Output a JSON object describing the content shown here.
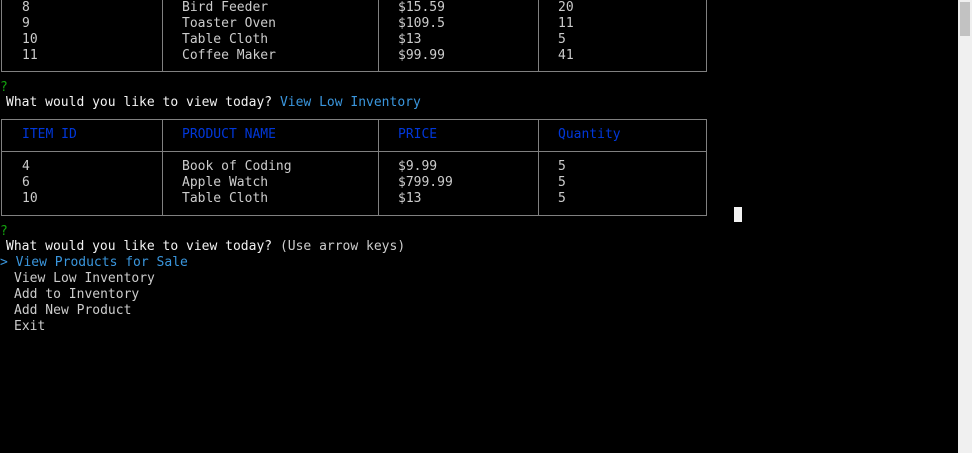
{
  "top_table": {
    "rows": [
      [
        "8",
        "Bird Feeder",
        "$15.59",
        "20"
      ],
      [
        "9",
        "Toaster Oven",
        "$109.5",
        "11"
      ],
      [
        "10",
        "Table Cloth",
        "$13",
        "5"
      ],
      [
        "11",
        "Coffee Maker",
        "$99.99",
        "41"
      ]
    ]
  },
  "prompt1": {
    "mark": "?",
    "question": "What would you like to view today?",
    "answer": "View Low Inventory"
  },
  "low_inventory_table": {
    "headers": [
      "ITEM ID",
      "PRODUCT NAME",
      "PRICE",
      "Quantity"
    ],
    "rows": [
      [
        "4",
        "Book of Coding",
        "$9.99",
        "5"
      ],
      [
        "6",
        "Apple Watch",
        "$799.99",
        "5"
      ],
      [
        "10",
        "Table Cloth",
        "$13",
        "5"
      ]
    ]
  },
  "prompt2": {
    "mark": "?",
    "question": "What would you like to view today?",
    "hint": "(Use arrow keys)",
    "pointer": ">",
    "choices": [
      "View Products for Sale",
      "View Low Inventory",
      "Add to Inventory",
      "Add New Product",
      "Exit"
    ],
    "selected_index": 0
  },
  "colors": {
    "background": "#000000",
    "text": "#cccccc",
    "question_mark": "#13a10e",
    "answer": "#3a96dd",
    "table_header": "#0037da",
    "border": "#808080"
  }
}
